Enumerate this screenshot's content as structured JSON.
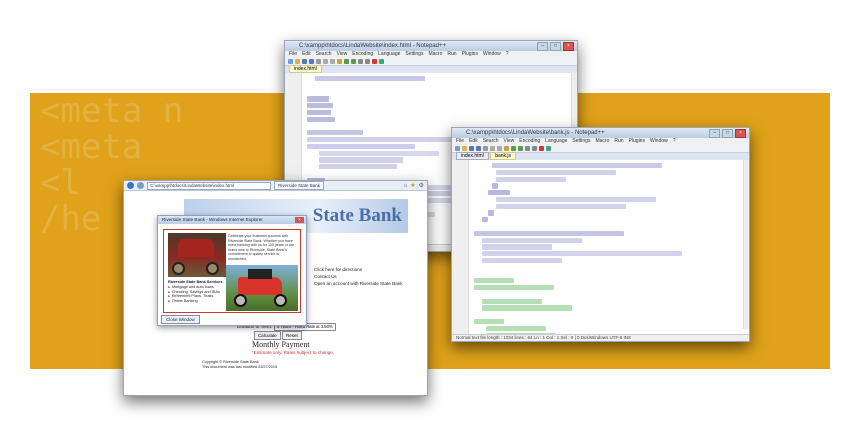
{
  "background": {
    "band_color": "#dfa21a",
    "ghost_lines": [
      "<meta n",
      "<meta",
      "<l",
      "/he"
    ]
  },
  "code_editor_back": {
    "title": "C:\\xampp\\htdocs\\LindaWebsite\\index.html - Notepad++",
    "menu": [
      "File",
      "Edit",
      "Search",
      "View",
      "Encoding",
      "Language",
      "Settings",
      "Macro",
      "Run",
      "Plugins",
      "Window",
      "?"
    ],
    "tab": "index.html"
  },
  "code_editor_front": {
    "title": "C:\\xampp\\htdocs\\LindaWebsite\\bank.js - Notepad++",
    "menu": [
      "File",
      "Edit",
      "Search",
      "View",
      "Encoding",
      "Language",
      "Settings",
      "Macro",
      "Run",
      "Plugins",
      "Window",
      "?"
    ],
    "tabs": [
      "index.html",
      "bank.js"
    ],
    "status": "Normal text file     length : 1034   lines : 64       Ln : 1   Col : 1   Sel : 0 | 0       Dos\\Windows   UTF-8   INS"
  },
  "browser": {
    "address": "C:\\xampp\\htdocs\\LindaWebsite\\index.html",
    "tab": "Riverside State Bank",
    "bank_name": "State Bank",
    "links": [
      "Click here for directions",
      "Contact Us",
      "Open an account with Riverside State Bank"
    ],
    "select_label": "Duration of Term:",
    "select_value": "5 Years - Fixed Rate at 3.50%",
    "calculate_button": "Calculate",
    "reset_button": "Reset",
    "monthly_payment": "Monthly Payment",
    "disclaimer": "*Estimate only. Rates subject to change.",
    "footer_lines": [
      "Copyright © Riverside State Bank",
      "This document was last modified 03/27/2015"
    ]
  },
  "popup": {
    "title": "Riverside State Bank - Windows Internet Explorer",
    "description": "Celebrate your business success with Riverside State Bank. Whether you have been banking with us for 100 years or are brand new to Riverside, State Bank's commitment to quality service is unmatched.",
    "services_heading": "Riverside State Bank Services",
    "services": [
      "Mortgage and auto loans",
      "Checking, Savings and IRAs",
      "Retirement Plans, Trusts",
      "Online Banking"
    ],
    "close_button": "Close Window"
  }
}
